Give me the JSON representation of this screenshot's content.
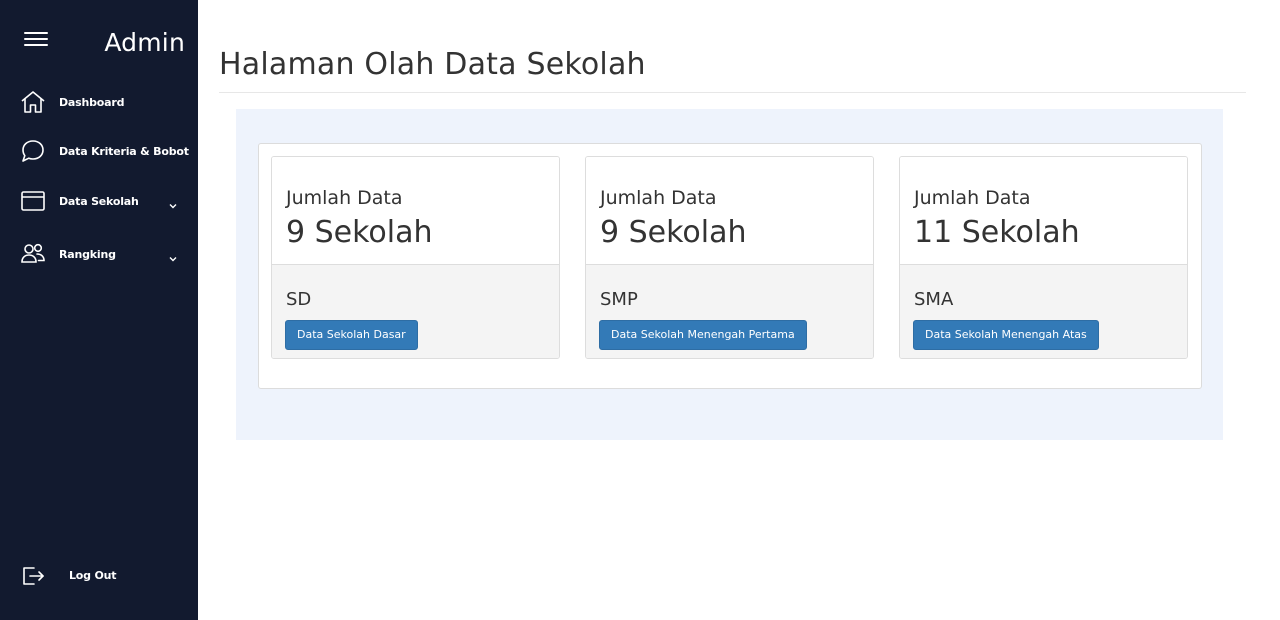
{
  "sidebar": {
    "brand": "Admin",
    "items": [
      {
        "label": "Dashboard",
        "icon": "home-icon"
      },
      {
        "label": "Data Kriteria & Bobot",
        "icon": "chat-bubble-icon"
      },
      {
        "label": "Data Sekolah",
        "icon": "folder-icon",
        "expandable": true
      },
      {
        "label": "Rangking",
        "icon": "users-icon",
        "expandable": true
      }
    ],
    "logout": {
      "label": "Log Out",
      "icon": "logout-icon"
    }
  },
  "main": {
    "title": "Halaman Olah Data Sekolah",
    "cards": [
      {
        "caption": "Jumlah Data",
        "count": "9 Sekolah",
        "level": "SD",
        "button": "Data Sekolah Dasar"
      },
      {
        "caption": "Jumlah Data",
        "count": "9 Sekolah",
        "level": "SMP",
        "button": "Data Sekolah Menengah Pertama"
      },
      {
        "caption": "Jumlah Data",
        "count": "11 Sekolah",
        "level": "SMA",
        "button": "Data Sekolah Menengah Atas"
      }
    ]
  },
  "colors": {
    "sidebar_bg": "#121a2f",
    "panel_bg": "#eef3fc",
    "primary_button": "#337ab7",
    "card_footer": "#f4f4f4"
  }
}
